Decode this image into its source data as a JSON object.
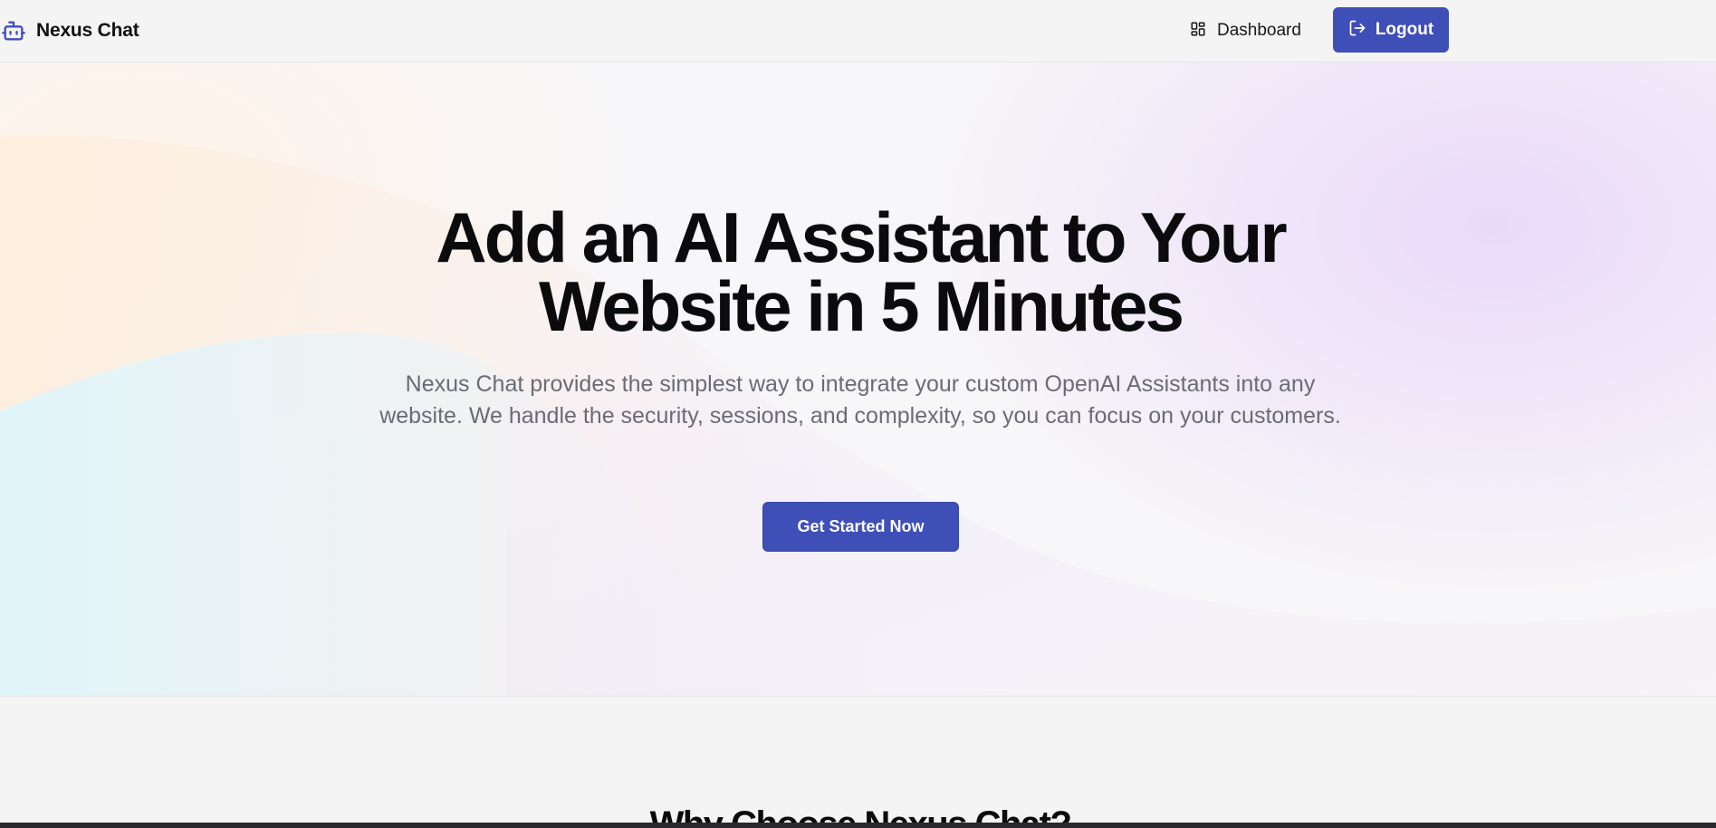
{
  "header": {
    "brand": {
      "name": "Nexus Chat",
      "icon": "robot-icon"
    },
    "nav": {
      "dashboard_label": "Dashboard",
      "dashboard_icon": "dashboard-grid-icon",
      "logout_label": "Logout",
      "logout_icon": "logout-icon"
    }
  },
  "hero": {
    "title_line1": "Add an AI Assistant to Your",
    "title_line2": "Website in 5 Minutes",
    "subtitle": "Nexus Chat provides the simplest way to integrate your custom OpenAI Assistants into any website. We handle the security, sessions, and complexity, so you can focus on your customers.",
    "cta_label": "Get Started Now"
  },
  "features": {
    "heading": "Why Choose Nexus Chat?"
  },
  "colors": {
    "accent": "#3f4fb8",
    "text_primary": "#0b0b0d",
    "text_muted": "#6b6b76",
    "background": "#f4f4f5"
  }
}
